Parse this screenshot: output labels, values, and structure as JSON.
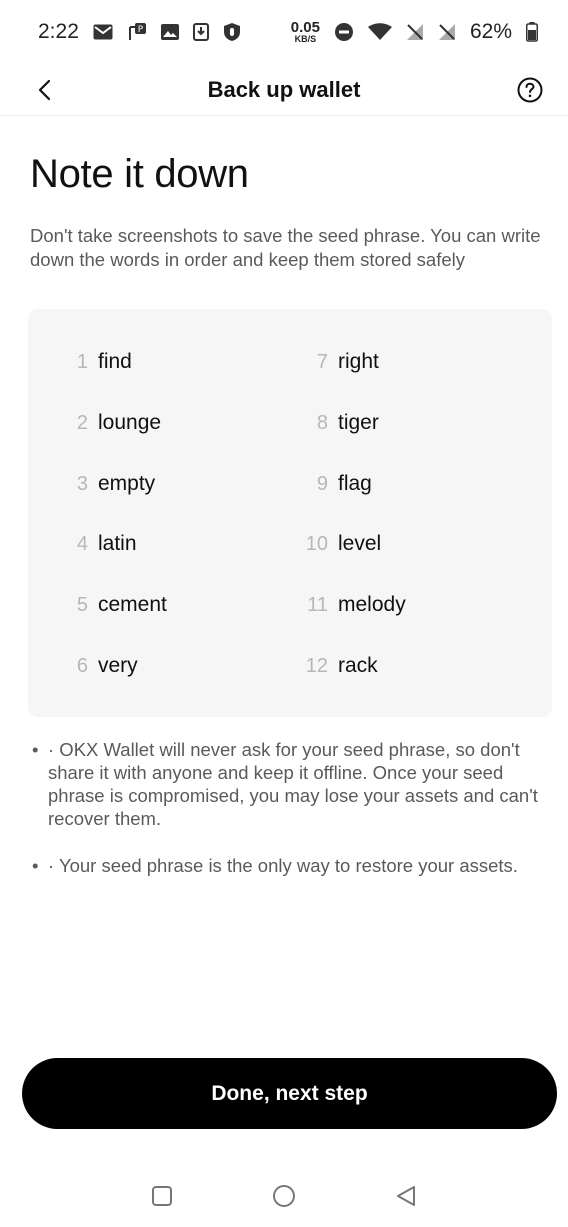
{
  "status_bar": {
    "time": "2:22",
    "net_speed_value": "0.05",
    "net_speed_unit": "KB/S",
    "battery": "62%"
  },
  "header": {
    "title": "Back up wallet",
    "back_icon": "chevron-left-icon",
    "help_icon": "question-circle-icon"
  },
  "main": {
    "title": "Note it down",
    "description": "Don't take screenshots to save the seed phrase. You can write down the words in order and keep them stored safely"
  },
  "seed_phrase": [
    {
      "num": "1",
      "word": "find"
    },
    {
      "num": "2",
      "word": "lounge"
    },
    {
      "num": "3",
      "word": "empty"
    },
    {
      "num": "4",
      "word": "latin"
    },
    {
      "num": "5",
      "word": "cement"
    },
    {
      "num": "6",
      "word": "very"
    },
    {
      "num": "7",
      "word": "right"
    },
    {
      "num": "8",
      "word": "tiger"
    },
    {
      "num": "9",
      "word": "flag"
    },
    {
      "num": "10",
      "word": "level"
    },
    {
      "num": "11",
      "word": "melody"
    },
    {
      "num": "12",
      "word": "rack"
    }
  ],
  "notes": [
    "· OKX Wallet will never ask for your seed phrase, so don't share it with anyone and keep it offline. Once your seed phrase is compromised, you may lose your assets and can't recover them.",
    "· Your seed phrase is the only way to restore your assets."
  ],
  "cta": {
    "label": "Done, next step"
  },
  "colors": {
    "background": "#ffffff",
    "card": "#f6f6f6",
    "button": "#000000",
    "button_text": "#ffffff",
    "muted_text": "#5a5a5a",
    "number_text": "#b7b7b7"
  }
}
